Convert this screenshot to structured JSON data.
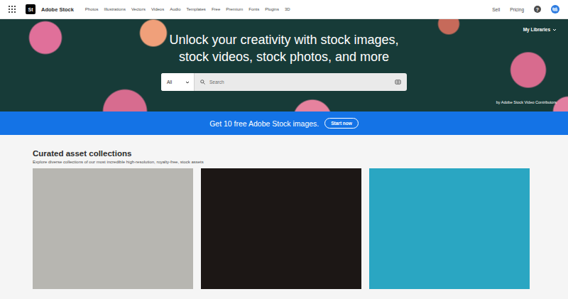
{
  "nav": {
    "logo": "St",
    "brand": "Adobe Stock",
    "items": [
      "Photos",
      "Illustrations",
      "Vectors",
      "Videos",
      "Audio",
      "Templates",
      "Free",
      "Premium",
      "Fonts",
      "Plugins",
      "3D"
    ],
    "links": [
      "Sell",
      "Pricing"
    ],
    "help": "?"
  },
  "hero": {
    "title_lines": [
      "Unlock your creativity with stock images,",
      "stock videos, stock photos, and more"
    ],
    "libraries": "My Libraries",
    "search": {
      "scope": "All",
      "placeholder": "Search"
    },
    "credit": "by Adobe Stock Video Contributors"
  },
  "banner": {
    "text": "Get 10 free Adobe Stock images.",
    "button": "Start now"
  },
  "collections": {
    "title": "Curated asset collections",
    "subtitle": "Explore diverse collections of our most incredible high-resolution, royalty-free, stock assets",
    "cards": [
      {
        "color": "#b7b6b1"
      },
      {
        "color": "#1c1715"
      },
      {
        "color": "#2aa6c2"
      }
    ]
  }
}
